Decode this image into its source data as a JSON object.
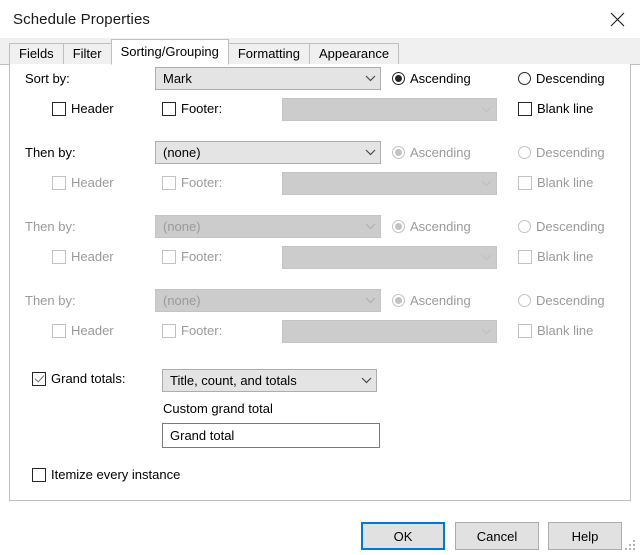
{
  "window": {
    "title": "Schedule Properties",
    "close_icon": "close-icon"
  },
  "tabs": [
    {
      "label": "Fields",
      "active": false
    },
    {
      "label": "Filter",
      "active": false
    },
    {
      "label": "Sorting/Grouping",
      "active": true
    },
    {
      "label": "Formatting",
      "active": false
    },
    {
      "label": "Appearance",
      "active": false
    }
  ],
  "sort_rows": [
    {
      "label": "Sort by:",
      "label_disabled": false,
      "field": "Mark",
      "field_disabled": false,
      "ascending_label": "Ascending",
      "ascending_checked": true,
      "ascending_disabled": false,
      "descending_label": "Descending",
      "descending_checked": false,
      "descending_disabled": false,
      "header_label": "Header",
      "header_checked": false,
      "header_disabled": false,
      "footer_label": "Footer:",
      "footer_checked": false,
      "footer_disabled": false,
      "footer_value": "",
      "footer_combo_disabled": true,
      "blank_label": "Blank line",
      "blank_checked": false,
      "blank_disabled": false
    },
    {
      "label": "Then by:",
      "label_disabled": false,
      "field": "(none)",
      "field_disabled": false,
      "ascending_label": "Ascending",
      "ascending_checked": true,
      "ascending_disabled": true,
      "descending_label": "Descending",
      "descending_checked": false,
      "descending_disabled": true,
      "header_label": "Header",
      "header_checked": false,
      "header_disabled": true,
      "footer_label": "Footer:",
      "footer_checked": false,
      "footer_disabled": true,
      "footer_value": "",
      "footer_combo_disabled": true,
      "blank_label": "Blank line",
      "blank_checked": false,
      "blank_disabled": true
    },
    {
      "label": "Then by:",
      "label_disabled": true,
      "field": "(none)",
      "field_disabled": true,
      "ascending_label": "Ascending",
      "ascending_checked": true,
      "ascending_disabled": true,
      "descending_label": "Descending",
      "descending_checked": false,
      "descending_disabled": true,
      "header_label": "Header",
      "header_checked": false,
      "header_disabled": true,
      "footer_label": "Footer:",
      "footer_checked": false,
      "footer_disabled": true,
      "footer_value": "",
      "footer_combo_disabled": true,
      "blank_label": "Blank line",
      "blank_checked": false,
      "blank_disabled": true
    },
    {
      "label": "Then by:",
      "label_disabled": true,
      "field": "(none)",
      "field_disabled": true,
      "ascending_label": "Ascending",
      "ascending_checked": true,
      "ascending_disabled": true,
      "descending_label": "Descending",
      "descending_checked": false,
      "descending_disabled": true,
      "header_label": "Header",
      "header_checked": false,
      "header_disabled": true,
      "footer_label": "Footer:",
      "footer_checked": false,
      "footer_disabled": true,
      "footer_value": "",
      "footer_combo_disabled": true,
      "blank_label": "Blank line",
      "blank_checked": false,
      "blank_disabled": true
    }
  ],
  "grand_totals": {
    "checkbox_label": "Grand totals:",
    "checked": true,
    "mode": "Title, count, and totals",
    "custom_label": "Custom grand total",
    "custom_value": "Grand total"
  },
  "itemize": {
    "label": "Itemize every instance",
    "checked": false
  },
  "footer_buttons": {
    "ok": "OK",
    "cancel": "Cancel",
    "help": "Help"
  }
}
